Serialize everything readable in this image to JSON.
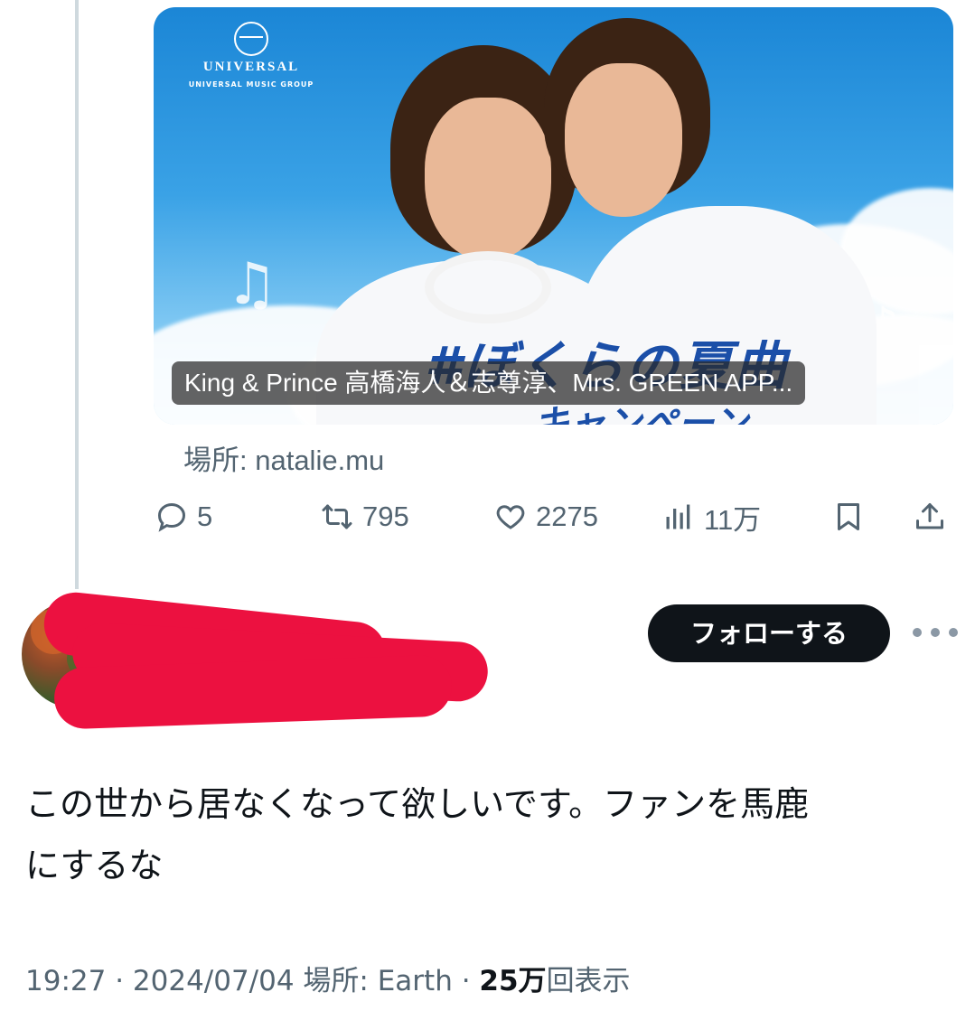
{
  "card": {
    "logo_name": "UNIVERSAL",
    "logo_sub": "UNIVERSAL MUSIC GROUP",
    "poster_title": "#ぼくらの夏曲",
    "poster_sub": "キャンペーン",
    "caption": "King & Prince 高橋海人＆志尊淳、Mrs. GREEN APP...",
    "source": "場所: natalie.mu"
  },
  "actions": {
    "replies": "5",
    "retweets": "795",
    "likes": "2275",
    "views": "11万"
  },
  "reply_tweet": {
    "follow_label": "フォローする",
    "text_line1": "この世から居なくなって欲しいです。ファンを馬鹿",
    "text_line2": "にするな",
    "meta_time": "19:27 · 2024/07/04 場所: Earth · ",
    "meta_views_num": "25万",
    "meta_views_suffix": "回表示"
  },
  "colors": {
    "muted_text": "#536471",
    "follow_button": "#0f1419",
    "redaction": "#ec1140",
    "thread_line": "#cfd9de"
  },
  "icons": [
    "reply-icon",
    "retweet-icon",
    "like-icon",
    "views-icon",
    "bookmark-icon",
    "share-icon",
    "more-icon"
  ]
}
